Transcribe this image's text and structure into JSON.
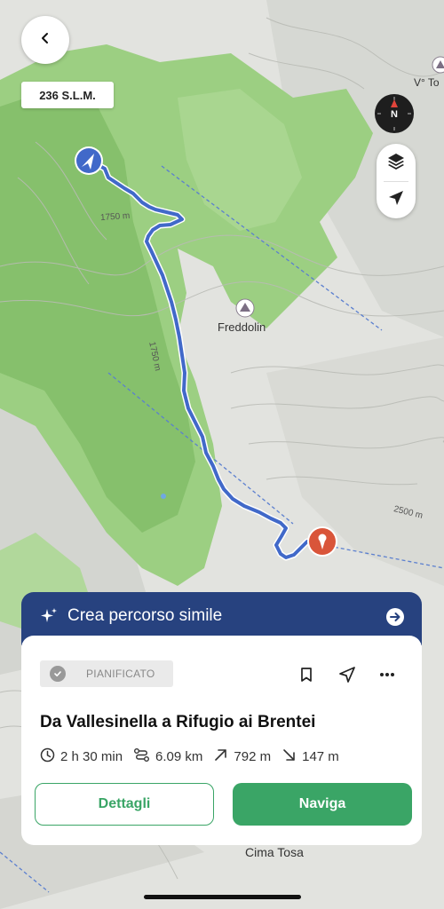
{
  "map": {
    "altitude_badge": "236 S.L.M.",
    "compass_label": "N",
    "labels": {
      "freddolin": "Freddolin",
      "contour_1750_a": "1750 m",
      "contour_1750_b": "1750 m",
      "contour_2500": "2500 m",
      "cima_tosa": "Cima Tosa",
      "top_right": "V° To"
    }
  },
  "sheet": {
    "header_title": "Crea percorso simile",
    "status": "PIANIFICATO",
    "route_title": "Da Vallesinella a Rifugio ai Brentei",
    "stats": {
      "duration": "2 h 30 min",
      "distance": "6.09 km",
      "ascent": "792 m",
      "descent": "147 m"
    },
    "details_button": "Dettagli",
    "navigate_button": "Naviga"
  },
  "colors": {
    "header_bg": "#27427f",
    "accent_green": "#3aa566",
    "route_blue": "#4169c9",
    "end_marker": "#d9553a"
  }
}
